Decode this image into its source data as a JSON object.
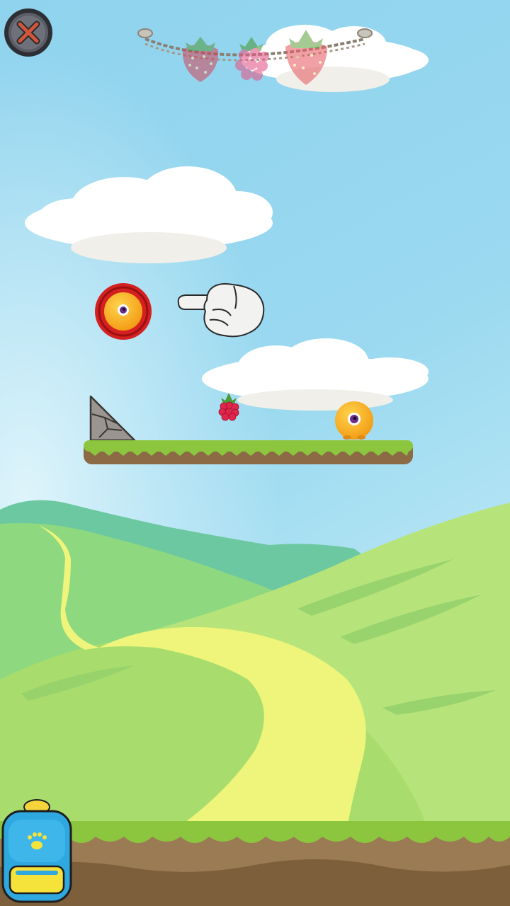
{
  "game": {
    "colors": {
      "sky_top": "#8fd3ee",
      "sky_bottom": "#bfe8f6",
      "grass": "#8cc63f",
      "dirt": "#9b7b54",
      "hill_light": "#c6ea7a",
      "hill_mid": "#a6dc6b",
      "hill_dark": "#6cc8a0",
      "path": "#eef57a",
      "ball_yellow": "#f7b529",
      "target_red": "#d42020",
      "backpack_blue": "#2fa8e0"
    },
    "hud": {
      "close_icon": "close-x-icon",
      "collectibles": [
        {
          "kind": "strawberry",
          "collected": false
        },
        {
          "kind": "raspberry",
          "collected": false
        },
        {
          "kind": "strawberry",
          "collected": false
        }
      ]
    },
    "level": {
      "start_marker": "red-ring-with-ball",
      "tutorial_hint": "pointing-hand",
      "pickup": "raspberry",
      "player": "yellow-one-eyed-ball",
      "platform": "grass-platform",
      "ramp": "stone-ramp"
    },
    "inventory": {
      "icon": "backpack-icon"
    }
  }
}
